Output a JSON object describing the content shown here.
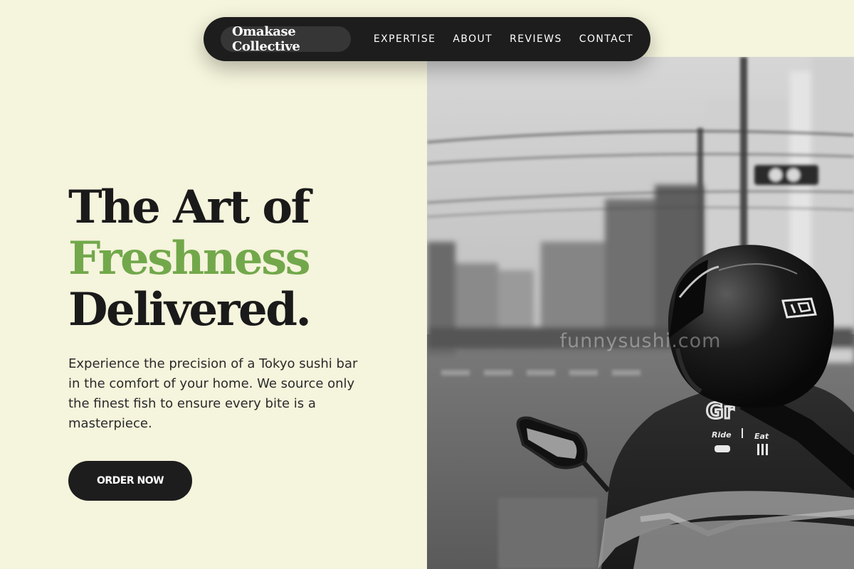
{
  "nav": {
    "brand": "Omakase Collective",
    "links": [
      "EXPERTISE",
      "ABOUT",
      "REVIEWS",
      "CONTACT"
    ]
  },
  "hero": {
    "headline_line1": "The Art of",
    "headline_line2": "Freshness",
    "headline_line3": "Delivered.",
    "description": "Experience the precision of a Tokyo sushi bar in the comfort of your home. We source only the finest fish to ensure every bite is a masterpiece.",
    "cta_label": "ORDER NOW"
  },
  "image": {
    "watermark": "funnysushi.com",
    "jacket_text_brand": "Gr",
    "jacket_text_ride": "Ride",
    "jacket_text_eat": "Eat"
  },
  "colors": {
    "background": "#f5f4dc",
    "dark": "#1d1d1d",
    "accent_green": "#72a84b"
  }
}
